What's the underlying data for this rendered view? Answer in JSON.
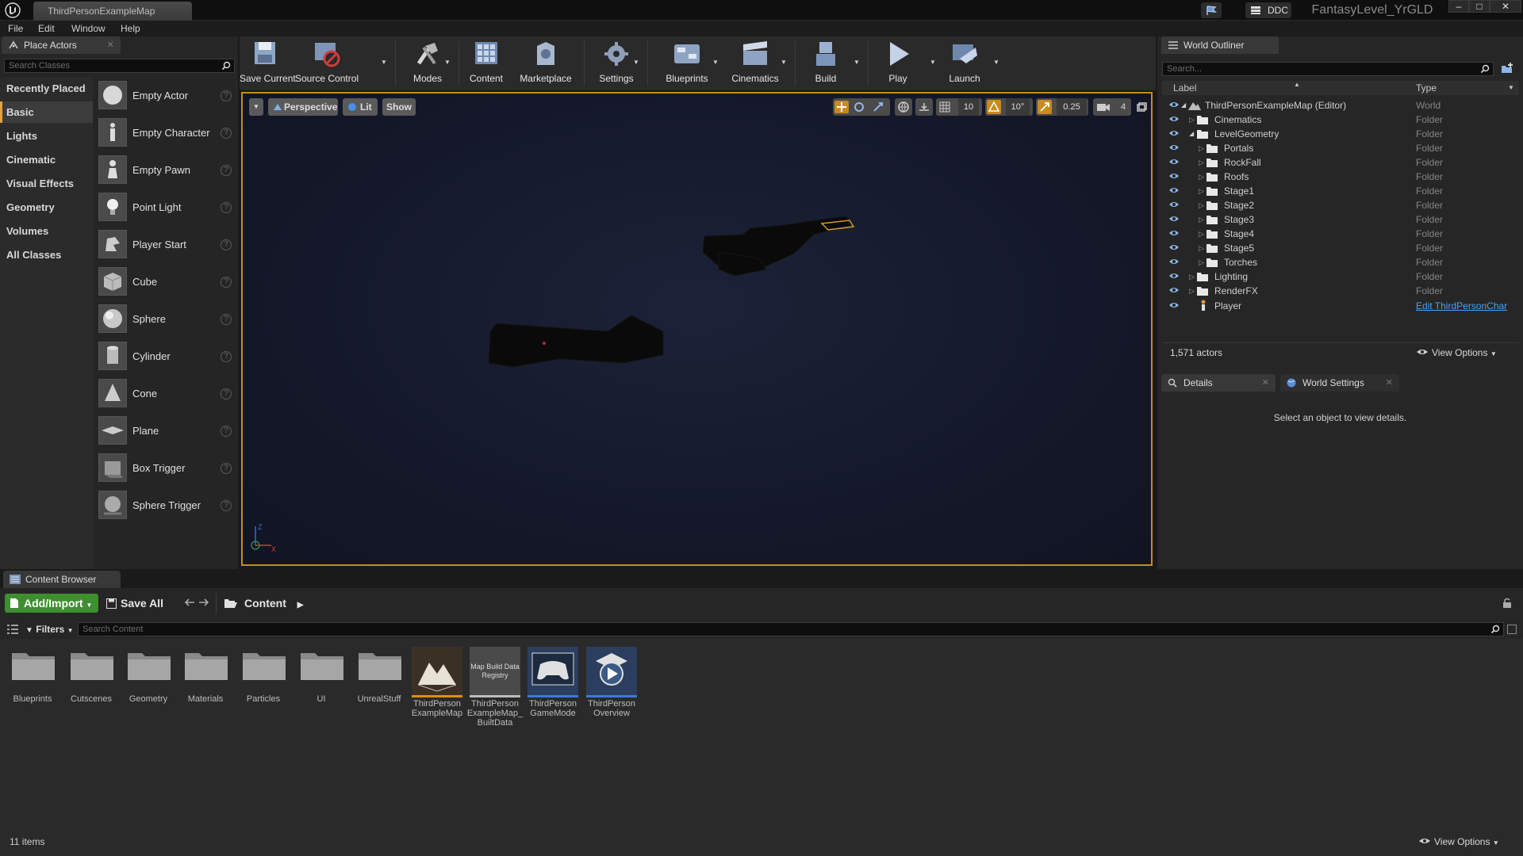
{
  "window": {
    "tab_title": "ThirdPersonExampleMap",
    "ddc_label": "DDC",
    "project_name": "FantasyLevel_YrGLD"
  },
  "menu": [
    "File",
    "Edit",
    "Window",
    "Help"
  ],
  "place_actors": {
    "tab_label": "Place Actors",
    "search_placeholder": "Search Classes",
    "categories": [
      "Recently Placed",
      "Basic",
      "Lights",
      "Cinematic",
      "Visual Effects",
      "Geometry",
      "Volumes",
      "All Classes"
    ],
    "active_category": "Basic",
    "actors": [
      "Empty Actor",
      "Empty Character",
      "Empty Pawn",
      "Point Light",
      "Player Start",
      "Cube",
      "Sphere",
      "Cylinder",
      "Cone",
      "Plane",
      "Box Trigger",
      "Sphere Trigger"
    ]
  },
  "toolbar": {
    "buttons": [
      "Save Current",
      "Source Control",
      "Modes",
      "Content",
      "Marketplace",
      "Settings",
      "Blueprints",
      "Cinematics",
      "Build",
      "Play",
      "Launch"
    ]
  },
  "viewport": {
    "perspective_label": "Perspective",
    "lit_label": "Lit",
    "show_label": "Show",
    "grid_snap": "10",
    "rotation_snap": "10°",
    "scale_snap": "0.25",
    "camera_speed": "4"
  },
  "world_outliner": {
    "tab_label": "World Outliner",
    "search_placeholder": "Search...",
    "col_label": "Label",
    "col_type": "Type",
    "rows": [
      {
        "label": "ThirdPersonExampleMap (Editor)",
        "type": "World"
      },
      {
        "label": "Cinematics",
        "type": "Folder"
      },
      {
        "label": "LevelGeometry",
        "type": "Folder"
      },
      {
        "label": "Portals",
        "type": "Folder"
      },
      {
        "label": "RockFall",
        "type": "Folder"
      },
      {
        "label": "Roofs",
        "type": "Folder"
      },
      {
        "label": "Stage1",
        "type": "Folder"
      },
      {
        "label": "Stage2",
        "type": "Folder"
      },
      {
        "label": "Stage3",
        "type": "Folder"
      },
      {
        "label": "Stage4",
        "type": "Folder"
      },
      {
        "label": "Stage5",
        "type": "Folder"
      },
      {
        "label": "Torches",
        "type": "Folder"
      },
      {
        "label": "Lighting",
        "type": "Folder"
      },
      {
        "label": "RenderFX",
        "type": "Folder"
      },
      {
        "label": "Player",
        "type": "Edit ThirdPersonChar"
      }
    ],
    "actor_count": "1,571 actors",
    "view_options": "View Options"
  },
  "details": {
    "tab_label": "Details",
    "world_settings_label": "World Settings",
    "empty_message": "Select an object to view details."
  },
  "content_browser": {
    "tab_label": "Content Browser",
    "add_import": "Add/Import",
    "save_all": "Save All",
    "path": "Content",
    "filters": "Filters",
    "search_placeholder": "Search Content",
    "folders": [
      "Blueprints",
      "Cutscenes",
      "Geometry",
      "Materials",
      "Particles",
      "UI",
      "UnrealStuff"
    ],
    "assets": [
      {
        "name": "ThirdPerson ExampleMap"
      },
      {
        "name": "ThirdPerson ExampleMap_ BuiltData",
        "thumb_text": "Map Build Data Registry"
      },
      {
        "name": "ThirdPerson GameMode"
      },
      {
        "name": "ThirdPerson Overview"
      }
    ],
    "item_count": "11 items",
    "view_options": "View Options"
  },
  "colors": {
    "accent_orange": "#c98a1e",
    "add_import_green": "#3e8f2f",
    "link_blue": "#4aa3f0"
  }
}
